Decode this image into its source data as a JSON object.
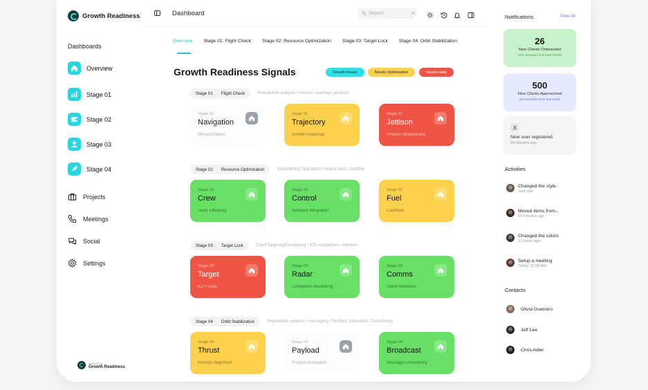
{
  "app": {
    "brand": "Growth Readiness",
    "bottom_brand_small": "powered by",
    "bottom_brand_name": "Growth Readiness"
  },
  "sidebar": {
    "section_title": "Dashboards",
    "stage_items": [
      {
        "label": "Overview",
        "icon": "home-icon"
      },
      {
        "label": "Stage 01",
        "icon": "chart-icon"
      },
      {
        "label": "Stage 02",
        "icon": "wallet-icon"
      },
      {
        "label": "Stage 03",
        "icon": "user-icon"
      },
      {
        "label": "Stage 04",
        "icon": "rocket-icon"
      }
    ],
    "plain_items": [
      {
        "label": "Projects",
        "icon": "briefcase-icon"
      },
      {
        "label": "Meetings",
        "icon": "phone-icon"
      },
      {
        "label": "Social",
        "icon": "chat-icon"
      },
      {
        "label": "Settings",
        "icon": "gear-icon"
      }
    ]
  },
  "topbar": {
    "title": "Dashboard",
    "search_placeholder": "Search",
    "search_shortcut": "⌘/"
  },
  "tabs": [
    "Overview",
    "Stage 01: Flight Check",
    "Stage 02: Resource Optimization",
    "Stage 03: Target Lock",
    "Stage 04: Orbit Stabilization"
  ],
  "main": {
    "title": "Growth Readiness Signals",
    "legend": [
      {
        "label": "Growth Ready",
        "color": "#2ee0e8"
      },
      {
        "label": "Needs Optimization",
        "color": "#fdd14e"
      },
      {
        "label": "Needs Help",
        "color": "#f05445"
      }
    ],
    "stages": [
      {
        "code": "Stage 01",
        "name": "Flight Check",
        "desc": "Post launch analysis / mission, roadmap, products",
        "cards": [
          {
            "stage": "Stage 01",
            "name": "Navigation",
            "sub": "Mission/Values",
            "status": "white"
          },
          {
            "stage": "Stage 01",
            "name": "Trajectory",
            "sub": "Growth Roadmap",
            "status": "yellow"
          },
          {
            "stage": "Stage 01",
            "name": "Jettison",
            "sub": "Product Streamlining",
            "status": "red"
          }
        ]
      },
      {
        "code": "Stage 02",
        "name": "Resource Optimization",
        "desc": "Streamlining Operations / teams, tech, cashflow",
        "cards": [
          {
            "stage": "Stage 02",
            "name": "Crew",
            "sub": "Team Efficiency",
            "status": "green"
          },
          {
            "stage": "Stage 02",
            "name": "Control",
            "sub": "Software Integration",
            "status": "green"
          },
          {
            "stage": "Stage 02",
            "name": "Fuel",
            "sub": "Cashflow",
            "status": "yellow"
          }
        ]
      },
      {
        "code": "Stage 03",
        "name": "Target Lock",
        "desc": "Client Targeting/Positioning / ICP, competitors, retention",
        "cards": [
          {
            "stage": "Stage 03",
            "name": "Target",
            "sub": "ICP Focus",
            "status": "red"
          },
          {
            "stage": "Stage 03",
            "name": "Radar",
            "sub": "Competitor Monitoring",
            "status": "green"
          },
          {
            "stage": "Stage 03",
            "name": "Comms",
            "sub": "Client Retention",
            "status": "green"
          }
        ]
      },
      {
        "code": "Stage 04",
        "name": "Orbit Stabilization",
        "desc": "Repeatable systems / messaging / RevOps, Innovation, Consistency",
        "cards": [
          {
            "stage": "Stage 04",
            "name": "Thrust",
            "sub": "RevOps Alignment",
            "status": "yellow"
          },
          {
            "stage": "Stage 04",
            "name": "Payload",
            "sub": "Product Innovation",
            "status": "white"
          },
          {
            "stage": "Stage 04",
            "name": "Broadcast",
            "sub": "Message Consistency",
            "status": "green"
          }
        ]
      }
    ]
  },
  "notifications": {
    "title": "Notifications",
    "view_all": "View All",
    "stats": [
      {
        "value": "26",
        "label": "New Clients Onboarded",
        "sub": "15% increase from last month",
        "bg": "#c8f2cb",
        "sub_color": "#3fa34a"
      },
      {
        "value": "500",
        "label": "New Clients Approached",
        "sub": "5% increase from last week",
        "bg": "#e5eaff",
        "sub_color": "#5a6fd6"
      }
    ],
    "note": {
      "text": "New user registered.",
      "time": "59 minutes ago"
    }
  },
  "activities": {
    "title": "Activities",
    "items": [
      {
        "title": "Changed the style.",
        "time": "Just now",
        "avatar": "#6b5a4d"
      },
      {
        "title": "Moved items from...",
        "time": "59 minutes ago",
        "avatar": "#3a2a24"
      },
      {
        "title": "Changed the colors",
        "time": "12 hours ago",
        "avatar": "#2d3a40"
      },
      {
        "title": "Setup a meeting",
        "time": "Today, 11:59 AM",
        "avatar": "#5a3a2a"
      }
    ]
  },
  "contacts": {
    "title": "Contacts",
    "items": [
      {
        "name": "Olivia Guerrero",
        "avatar": "#8a6a5a"
      },
      {
        "name": "Jeff Lee",
        "avatar": "#2a2a2a"
      },
      {
        "name": "Chris Adler",
        "avatar": "#1e1e1e"
      }
    ]
  }
}
